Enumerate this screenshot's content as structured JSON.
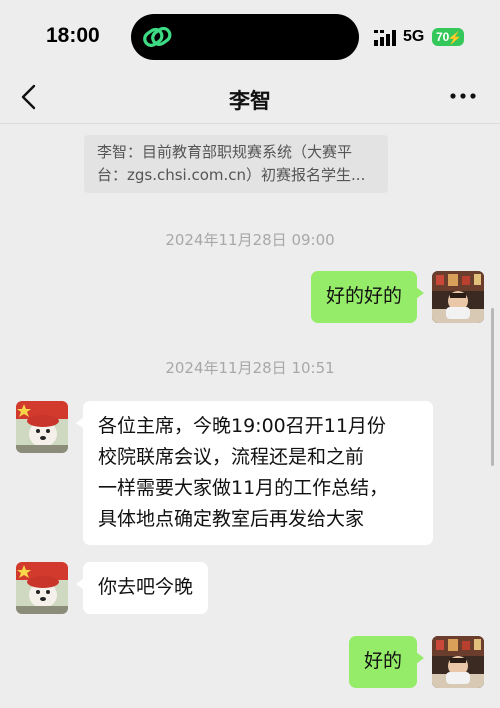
{
  "status_bar": {
    "time": "18:00",
    "network": "5G",
    "battery": "70",
    "icons": [
      "link-icon",
      "signal-icon",
      "battery-charging-icon"
    ]
  },
  "nav": {
    "title": "李智",
    "back_icon": "chevron-left-icon",
    "more_icon": "more-icon"
  },
  "quote": {
    "line1": "李智：目前教育部职规赛系统（大赛平",
    "line2": "台：zgs.chsi.com.cn）初赛报名学生..."
  },
  "messages": [
    {
      "type": "timestamp",
      "text": "2024年11月28日 09:00"
    },
    {
      "type": "sent",
      "text": "好的好的"
    },
    {
      "type": "timestamp",
      "text": "2024年11月28日 10:51"
    },
    {
      "type": "received",
      "lines": [
        "各位主席，今晚19:00召开11月份",
        "校院联席会议，流程还是和之前",
        "一样需要大家做11月的工作总结，",
        "具体地点确定教室后再发给大家"
      ]
    },
    {
      "type": "received",
      "text": "你去吧今晚"
    },
    {
      "type": "sent",
      "text": "好的"
    }
  ],
  "colors": {
    "background": "#ededed",
    "sent_bubble": "#95ec69",
    "received_bubble": "#ffffff",
    "battery": "#34c759"
  }
}
